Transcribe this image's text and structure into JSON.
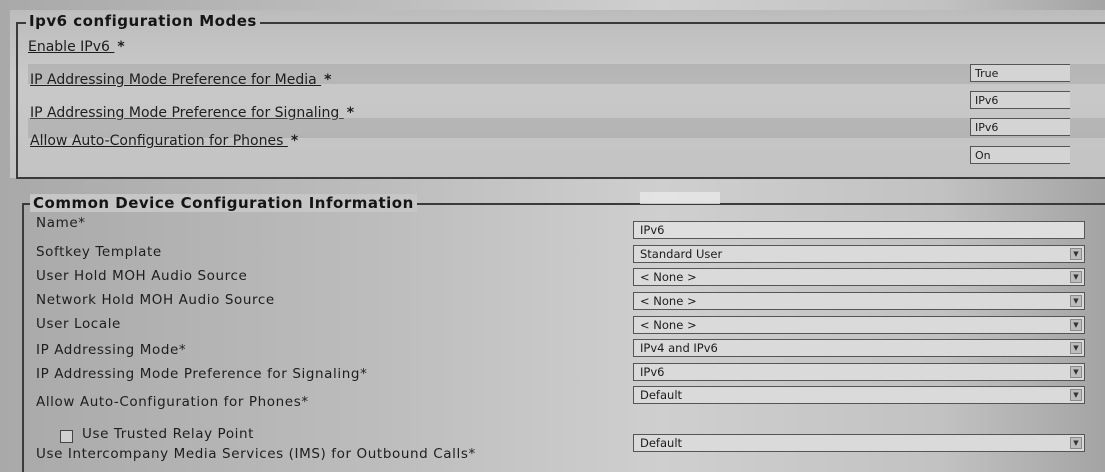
{
  "ipv6_section": {
    "legend": "Ipv6 configuration Modes",
    "rows": [
      {
        "label": "Enable IPv6 ",
        "value": ""
      },
      {
        "label": "IP Addressing Mode Preference for Media ",
        "value": "True"
      },
      {
        "label": "IP Addressing Mode Preference for Signaling ",
        "value": "IPv6"
      },
      {
        "label": "Allow Auto-Configuration for Phones ",
        "value": "IPv6"
      },
      {
        "label": "",
        "value": "On"
      }
    ],
    "required_mark": "*"
  },
  "common_section": {
    "legend": "Common Device Configuration Information",
    "fields": [
      {
        "label": "Name*",
        "value": "IPv6"
      },
      {
        "label": "Softkey Template",
        "value": "Standard User"
      },
      {
        "label": "User Hold MOH Audio Source",
        "value": "< None >"
      },
      {
        "label": "Network Hold MOH Audio Source",
        "value": "< None >"
      },
      {
        "label": "User Locale",
        "value": "< None >"
      },
      {
        "label": "IP Addressing Mode*",
        "value": "IPv4 and IPv6"
      },
      {
        "label": "IP Addressing Mode Preference for Signaling*",
        "value": "IPv6"
      },
      {
        "label": "Allow Auto-Configuration for Phones*",
        "value": "Default"
      }
    ],
    "trusted_relay_label": "Use Trusted Relay Point",
    "ims_label": "Use Intercompany Media Services (IMS) for Outbound Calls*",
    "ims_value": "Default"
  },
  "icons": {
    "dropdown": "dropdown-arrow-icon",
    "checkbox": "checkbox-icon"
  }
}
